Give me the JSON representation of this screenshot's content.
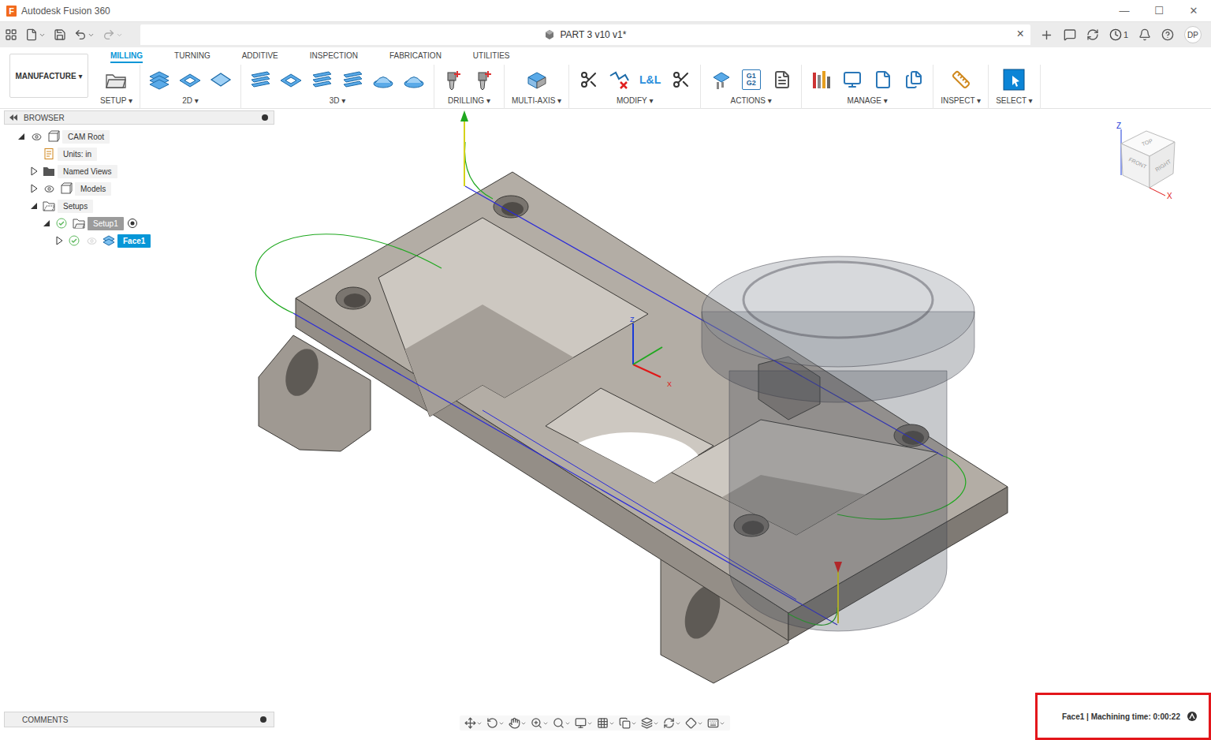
{
  "window": {
    "logo": "F",
    "title": "Autodesk Fusion 360",
    "controls": [
      "—",
      "☐",
      "✕"
    ]
  },
  "document": {
    "title": "PART 3 v10 v1*",
    "close": "×"
  },
  "header": {
    "jobs": "1",
    "user": "DP"
  },
  "workspace": {
    "label": "MANUFACTURE",
    "caret": "▾"
  },
  "ribbon_tabs": [
    {
      "label": "MILLING",
      "selected": true
    },
    {
      "label": "TURNING",
      "selected": false
    },
    {
      "label": "ADDITIVE",
      "selected": false
    },
    {
      "label": "INSPECTION",
      "selected": false
    },
    {
      "label": "FABRICATION",
      "selected": false
    },
    {
      "label": "UTILITIES",
      "selected": false
    }
  ],
  "groups": [
    {
      "label": "SETUP ▾",
      "tools": [
        {
          "kind": "setup"
        }
      ]
    },
    {
      "label": "2D ▾",
      "tools": [
        {
          "kind": "plate-stack"
        },
        {
          "kind": "pocket"
        },
        {
          "kind": "diamond"
        }
      ]
    },
    {
      "label": "3D ▾",
      "tools": [
        {
          "kind": "layers"
        },
        {
          "kind": "pocket"
        },
        {
          "kind": "layers"
        },
        {
          "kind": "layers"
        },
        {
          "kind": "dome"
        },
        {
          "kind": "dome"
        }
      ]
    },
    {
      "label": "DRILLING ▾",
      "tools": [
        {
          "kind": "drill"
        },
        {
          "kind": "drill"
        }
      ]
    },
    {
      "label": "MULTI-AXIS ▾",
      "tools": [
        {
          "kind": "multiaxis"
        }
      ]
    },
    {
      "label": "MODIFY ▾",
      "tools": [
        {
          "kind": "scissors"
        },
        {
          "kind": "delete-path"
        },
        {
          "kind": "text",
          "text": "L&L"
        },
        {
          "kind": "scissors"
        }
      ]
    },
    {
      "label": "ACTIONS ▾",
      "tools": [
        {
          "kind": "simulate"
        },
        {
          "kind": "gcode",
          "text": [
            "G1",
            "G2"
          ]
        },
        {
          "kind": "sheet"
        }
      ]
    },
    {
      "label": "MANAGE ▾",
      "tools": [
        {
          "kind": "tool-library"
        },
        {
          "kind": "machine"
        },
        {
          "kind": "post"
        },
        {
          "kind": "post-multi"
        }
      ]
    },
    {
      "label": "INSPECT ▾",
      "tools": [
        {
          "kind": "measure"
        }
      ]
    },
    {
      "label": "SELECT ▾",
      "tools": [
        {
          "kind": "select"
        }
      ]
    }
  ],
  "browser": {
    "title": "BROWSER",
    "items": [
      {
        "label": "CAM Root",
        "depth": 0,
        "kind": "root",
        "expandable": true,
        "expanded": true,
        "has_eye": true,
        "visible": true,
        "status_ok": false,
        "selected": false,
        "active": false
      },
      {
        "label": "Units: in",
        "depth": 1,
        "kind": "units",
        "expandable": false,
        "expanded": false,
        "has_eye": false,
        "visible": false,
        "status_ok": false,
        "selected": false,
        "active": false
      },
      {
        "label": "Named Views",
        "depth": 1,
        "kind": "folder",
        "expandable": true,
        "expanded": false,
        "has_eye": false,
        "visible": false,
        "status_ok": false,
        "selected": false,
        "active": false
      },
      {
        "label": "Models",
        "depth": 1,
        "kind": "models",
        "expandable": true,
        "expanded": false,
        "has_eye": true,
        "visible": true,
        "status_ok": false,
        "selected": false,
        "active": false
      },
      {
        "label": "Setups",
        "depth": 1,
        "kind": "setups",
        "expandable": true,
        "expanded": true,
        "has_eye": false,
        "visible": false,
        "status_ok": false,
        "selected": false,
        "active": false
      },
      {
        "label": "Setup1",
        "depth": 2,
        "kind": "setup",
        "expandable": true,
        "expanded": true,
        "has_eye": false,
        "visible": false,
        "status_ok": true,
        "selected": false,
        "active": true
      },
      {
        "label": "Face1",
        "depth": 3,
        "kind": "operation",
        "expandable": true,
        "expanded": false,
        "has_eye": true,
        "visible": false,
        "status_ok": true,
        "selected": true,
        "active": false
      }
    ]
  },
  "comments": {
    "title": "COMMENTS"
  },
  "viewcube": {
    "faces": [
      "TOP",
      "FRONT",
      "RIGHT"
    ],
    "axes": [
      "Z",
      "X"
    ]
  },
  "triad": {
    "axes": [
      "Z",
      "X"
    ]
  },
  "status_bar": {
    "text": "Face1 | Machining time: 0:00:22",
    "highlighted": true
  }
}
